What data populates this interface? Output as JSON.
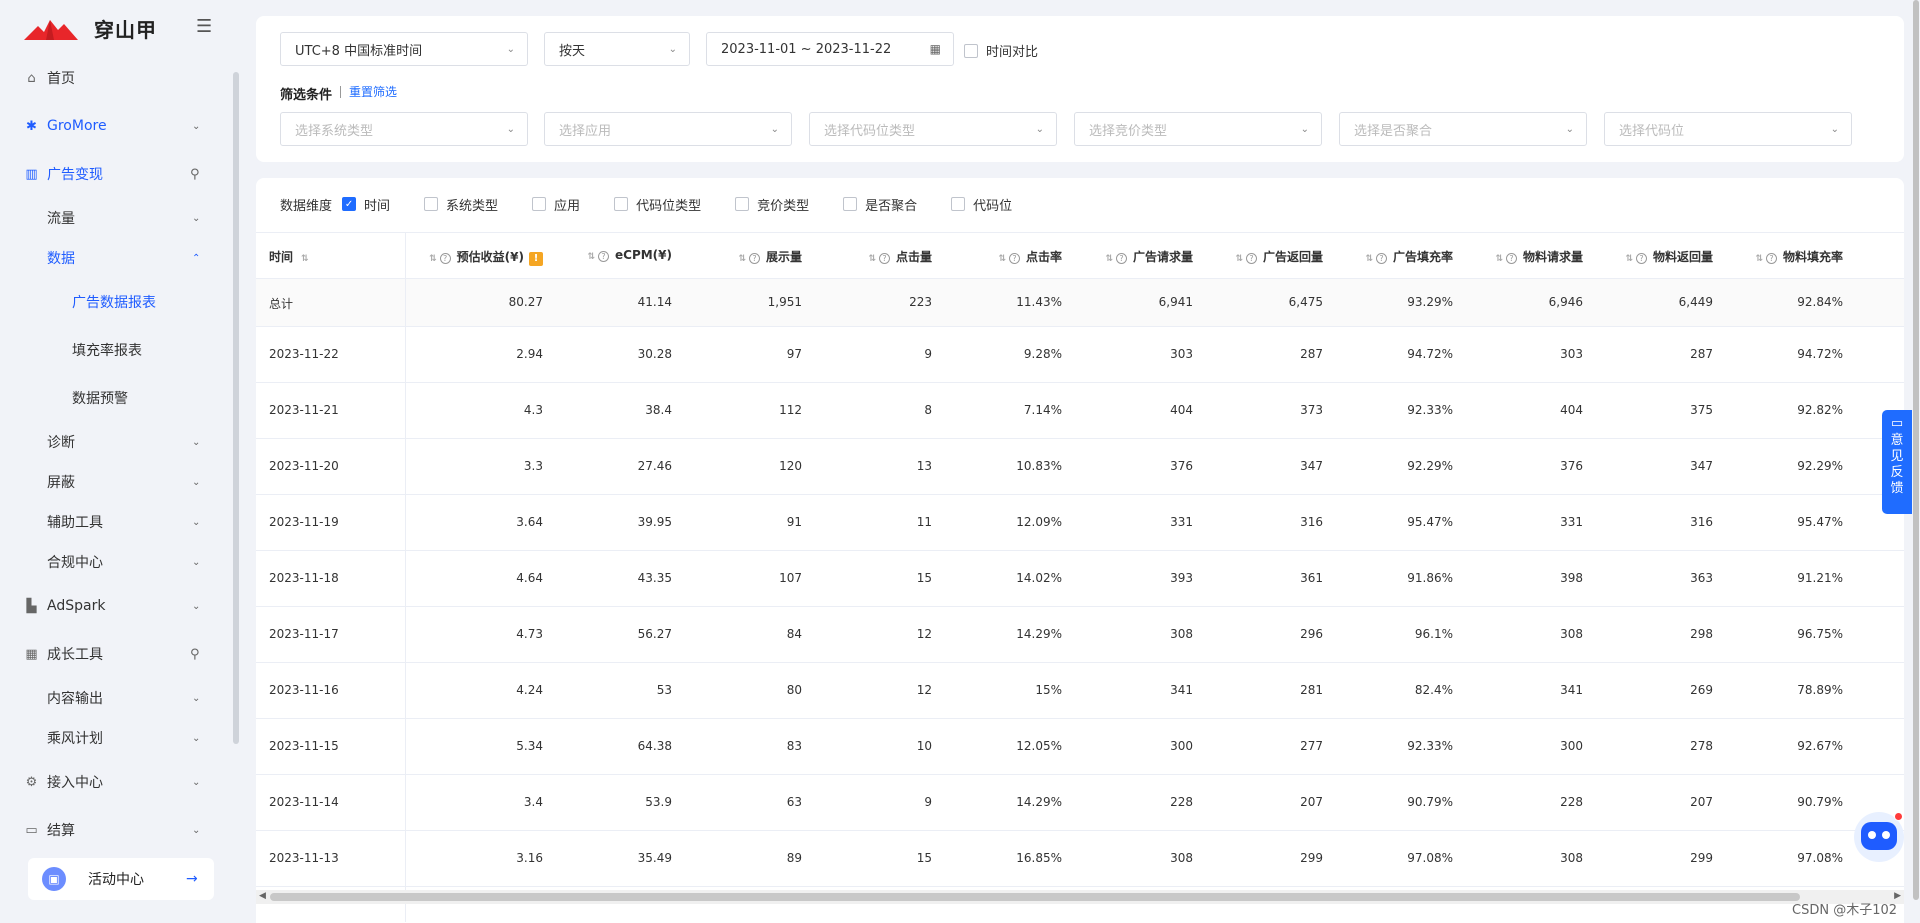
{
  "brand": {
    "name": "穿山甲"
  },
  "sidebar": {
    "items": [
      {
        "label": "首页",
        "icon": "home-icon"
      },
      {
        "label": "GroMore",
        "icon": "gromore-icon"
      },
      {
        "label": "广告变现",
        "icon": "chart-icon"
      },
      {
        "label": "流量"
      },
      {
        "label": "数据"
      },
      {
        "label": "广告数据报表"
      },
      {
        "label": "填充率报表"
      },
      {
        "label": "数据预警"
      },
      {
        "label": "诊断"
      },
      {
        "label": "屏蔽"
      },
      {
        "label": "辅助工具"
      },
      {
        "label": "合规中心"
      },
      {
        "label": "AdSpark",
        "icon": "adspark-icon"
      },
      {
        "label": "成长工具",
        "icon": "grid-icon"
      },
      {
        "label": "内容输出"
      },
      {
        "label": "乘风计划"
      },
      {
        "label": "接入中心",
        "icon": "plug-icon"
      },
      {
        "label": "结算",
        "icon": "wallet-icon"
      }
    ],
    "activity_label": "活动中心"
  },
  "filters": {
    "timezone": "UTC+8 中国标准时间",
    "granularity": "按天",
    "date_range": "2023-11-01 ~ 2023-11-22",
    "compare_label": "时间对比",
    "conditions_label": "筛选条件",
    "reset_label": "重置筛选",
    "placeholders": [
      "选择系统类型",
      "选择应用",
      "选择代码位类型",
      "选择竞价类型",
      "选择是否聚合",
      "选择代码位"
    ]
  },
  "dimensions": {
    "label": "数据维度",
    "options": [
      {
        "label": "时间",
        "checked": true
      },
      {
        "label": "系统类型",
        "checked": false
      },
      {
        "label": "应用",
        "checked": false
      },
      {
        "label": "代码位类型",
        "checked": false
      },
      {
        "label": "竞价类型",
        "checked": false
      },
      {
        "label": "是否聚合",
        "checked": false
      },
      {
        "label": "代码位",
        "checked": false
      }
    ]
  },
  "table": {
    "columns": [
      "时间",
      "预估收益(¥)",
      "eCPM(¥)",
      "展示量",
      "点击量",
      "点击率",
      "广告请求量",
      "广告返回量",
      "广告填充率",
      "物料请求量",
      "物料返回量",
      "物料填充率"
    ],
    "rows": [
      [
        "总计",
        "80.27",
        "41.14",
        "1,951",
        "223",
        "11.43%",
        "6,941",
        "6,475",
        "93.29%",
        "6,946",
        "6,449",
        "92.84%"
      ],
      [
        "2023-11-22",
        "2.94",
        "30.28",
        "97",
        "9",
        "9.28%",
        "303",
        "287",
        "94.72%",
        "303",
        "287",
        "94.72%"
      ],
      [
        "2023-11-21",
        "4.3",
        "38.4",
        "112",
        "8",
        "7.14%",
        "404",
        "373",
        "92.33%",
        "404",
        "375",
        "92.82%"
      ],
      [
        "2023-11-20",
        "3.3",
        "27.46",
        "120",
        "13",
        "10.83%",
        "376",
        "347",
        "92.29%",
        "376",
        "347",
        "92.29%"
      ],
      [
        "2023-11-19",
        "3.64",
        "39.95",
        "91",
        "11",
        "12.09%",
        "331",
        "316",
        "95.47%",
        "331",
        "316",
        "95.47%"
      ],
      [
        "2023-11-18",
        "4.64",
        "43.35",
        "107",
        "15",
        "14.02%",
        "393",
        "361",
        "91.86%",
        "398",
        "363",
        "91.21%"
      ],
      [
        "2023-11-17",
        "4.73",
        "56.27",
        "84",
        "12",
        "14.29%",
        "308",
        "296",
        "96.1%",
        "308",
        "298",
        "96.75%"
      ],
      [
        "2023-11-16",
        "4.24",
        "53",
        "80",
        "12",
        "15%",
        "341",
        "281",
        "82.4%",
        "341",
        "269",
        "78.89%"
      ],
      [
        "2023-11-15",
        "5.34",
        "64.38",
        "83",
        "10",
        "12.05%",
        "300",
        "277",
        "92.33%",
        "300",
        "278",
        "92.67%"
      ],
      [
        "2023-11-14",
        "3.4",
        "53.9",
        "63",
        "9",
        "14.29%",
        "228",
        "207",
        "90.79%",
        "228",
        "207",
        "90.79%"
      ],
      [
        "2023-11-13",
        "3.16",
        "35.49",
        "89",
        "15",
        "16.85%",
        "308",
        "299",
        "97.08%",
        "308",
        "299",
        "97.08%"
      ]
    ]
  },
  "feedback_label": "意见反馈",
  "watermark": "CSDN @木子102",
  "colors": {
    "accent": "#1f6cff",
    "brand_red": "#e8262a",
    "warning": "#f5a623"
  }
}
